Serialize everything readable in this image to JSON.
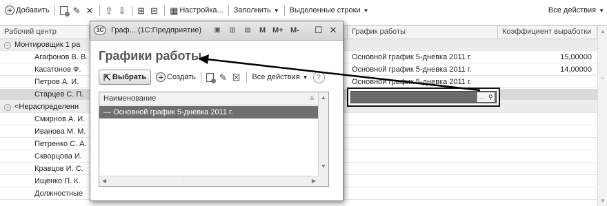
{
  "toolbar": {
    "add_label": "Добавить",
    "settings_label": "Настройка...",
    "fill_label": "Заполнить",
    "selected_rows_label": "Выделенные строки",
    "all_actions_label": "Все действия"
  },
  "table": {
    "columns": {
      "work_center": "Рабочий центр",
      "schedule": "График работы",
      "coef": "Коэффициент выработки"
    },
    "rows": [
      {
        "name": "Монтировщик 1 ра",
        "schedule": "",
        "coef": ""
      },
      {
        "name": "Агафонов В. В.",
        "schedule": "Основной график 5-дневка 2011 г.",
        "coef": "15,00000"
      },
      {
        "name": "Касатонов Ф.",
        "schedule": "Основной график 5-дневка 2011 г.",
        "coef": "14,00000"
      },
      {
        "name": "Петров А. И.",
        "schedule": "Основной график 5-дневка 2011 г.",
        "coef": ""
      },
      {
        "name": "Старцев С. П.",
        "schedule": "",
        "coef": ""
      },
      {
        "name": "<Нераспределенн",
        "schedule": "",
        "coef": ""
      },
      {
        "name": "Смирнов А. И.",
        "schedule": "",
        "coef": ""
      },
      {
        "name": "Иванова М. М.",
        "schedule": "",
        "coef": ""
      },
      {
        "name": "Петренко С. А.",
        "schedule": "",
        "coef": ""
      },
      {
        "name": "Скворцова И.",
        "schedule": "",
        "coef": ""
      },
      {
        "name": "Кравцов И. С.",
        "schedule": "",
        "coef": ""
      },
      {
        "name": "Ищенко П. К.",
        "schedule": "",
        "coef": ""
      },
      {
        "name": "Должностные",
        "schedule": "",
        "coef": ""
      }
    ]
  },
  "modal": {
    "window_title": "Граф... (1С:Предприятие)",
    "m_label": "M",
    "mplus_label": "M+",
    "mminus_label": "M-",
    "heading": "Графики работы",
    "select_label": "Выбрать",
    "create_label": "Создать",
    "all_actions_label": "Все действия",
    "help_label": "?",
    "list_header": "Наименование",
    "list_items": [
      "Основной график 5-дневка 2011 г."
    ]
  }
}
